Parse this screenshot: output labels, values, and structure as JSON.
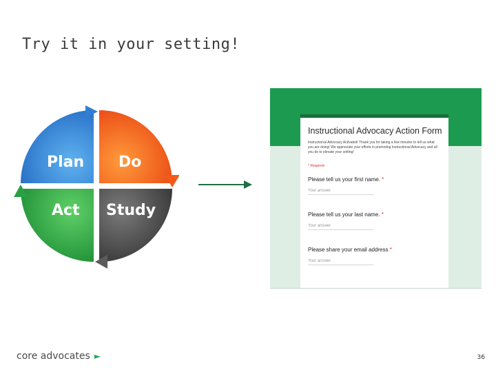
{
  "slide": {
    "title": "Try it in your setting!",
    "page_number": "36"
  },
  "cycle": {
    "plan": "Plan",
    "do": "Do",
    "act": "Act",
    "study": "Study",
    "colors": {
      "plan": "#2f7fd4",
      "do": "#f15a1a",
      "act": "#2aa043",
      "study": "#5c5c5c"
    }
  },
  "form": {
    "title": "Instructional Advocacy Action Form",
    "description": "Instructional Advocacy Activated! Thank you for taking a few minutes to tell us what you are doing! We appreciate your efforts in promoting Instructional Advocacy and all you do to elevate your setting!",
    "required_note": "* Required",
    "questions": [
      {
        "label": "Please tell us your first name.",
        "placeholder": "Your answer"
      },
      {
        "label": "Please tell us your last name.",
        "placeholder": "Your answer"
      },
      {
        "label": "Please share your email address",
        "placeholder": "Your answer"
      }
    ],
    "colors": {
      "header": "#1c9a50",
      "accent": "#1a6e3b",
      "background": "#dfeee5"
    }
  },
  "brand": {
    "name": "core advocates",
    "icon": "play-arrow-icon",
    "icon_glyph": "►"
  },
  "connector": {
    "icon": "right-arrow-icon",
    "color": "#1f6e43"
  }
}
